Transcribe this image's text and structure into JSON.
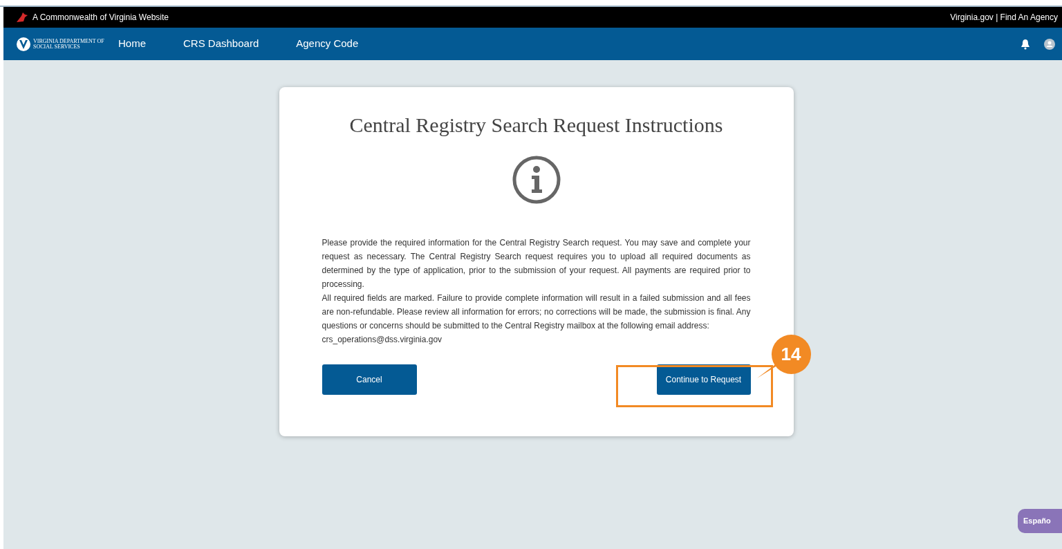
{
  "top_bar": {
    "title": "A Commonwealth of Virginia Website",
    "links": "Virginia.gov | Find An Agency"
  },
  "nav": {
    "logo_text": [
      "VIRGINIA DEPARTMENT OF",
      "SOCIAL SERVICES"
    ],
    "items": [
      "Home",
      "CRS Dashboard",
      "Agency Code"
    ]
  },
  "card": {
    "title": "Central Registry Search Request Instructions",
    "paragraphs": [
      "Please provide the required information for the Central Registry Search request. You may save and complete your request as necessary. The Central Registry Search request requires you to upload all required documents as determined by the type of application, prior to the submission of your request. All payments are required prior to processing.",
      "All required fields are marked. Failure to provide complete information will result in a failed submission and all fees are non-refundable. Please review all information for errors; no corrections will be made, the submission is final. Any questions or concerns should be submitted to the Central Registry mailbox at the following email address:"
    ],
    "email": "crs_operations@dss.virginia.gov",
    "buttons": [
      "Cancel",
      "Continue to Request"
    ]
  },
  "callout": {
    "number": "14"
  },
  "language_button": "Españo"
}
